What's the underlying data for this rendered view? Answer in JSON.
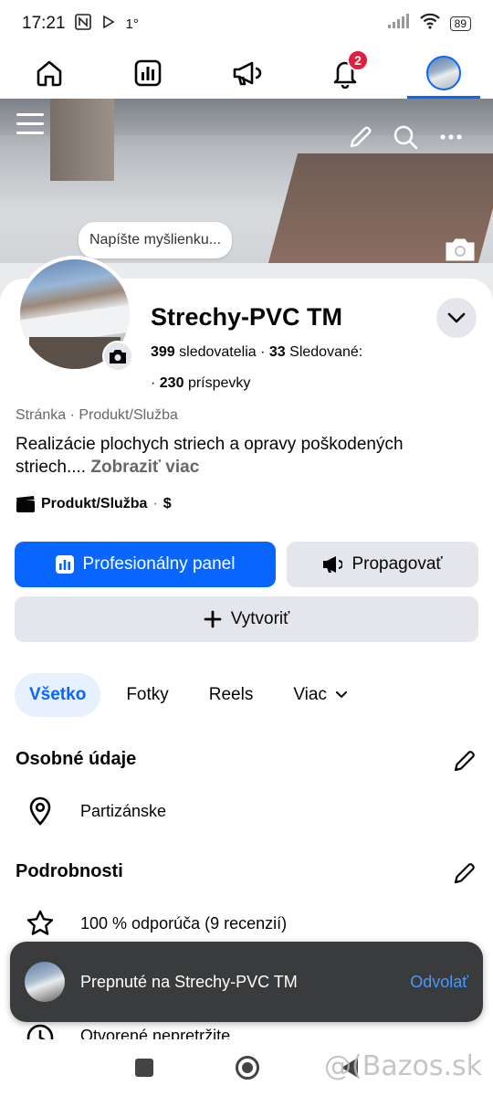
{
  "status_bar": {
    "time": "17:21",
    "battery": "89"
  },
  "nav": {
    "notification_count": "2"
  },
  "cover": {
    "thought_placeholder": "Napíšte myšlienku..."
  },
  "profile": {
    "name": "Strechy-PVC TM",
    "followers_count": "399",
    "followers_label": "sledovatelia",
    "following_count": "33",
    "following_label": "Sledované:",
    "posts_count": "230",
    "posts_label": "príspevky",
    "category": "Stránka · Produkt/Služba",
    "description": "Realizácie plochych striech a opravy poškodených striech....",
    "see_more": "Zobraziť viac",
    "tag": "Produkt/Služba",
    "price": "$"
  },
  "buttons": {
    "professional": "Profesionálny panel",
    "promote": "Propagovať",
    "create": "Vytvoriť"
  },
  "tabs": [
    "Všetko",
    "Fotky",
    "Reels",
    "Viac"
  ],
  "sections": {
    "personal": {
      "title": "Osobné údaje",
      "location": "Partizánske"
    },
    "details": {
      "title": "Podrobnosti",
      "rating": "100 % odporúča (9 recenzií)",
      "hours": "Otvorené nepretržite"
    }
  },
  "snackbar": {
    "text": "Prepnuté na Strechy-PVC TM",
    "action": "Odvolať"
  },
  "watermark": "@(Bazos.sk"
}
